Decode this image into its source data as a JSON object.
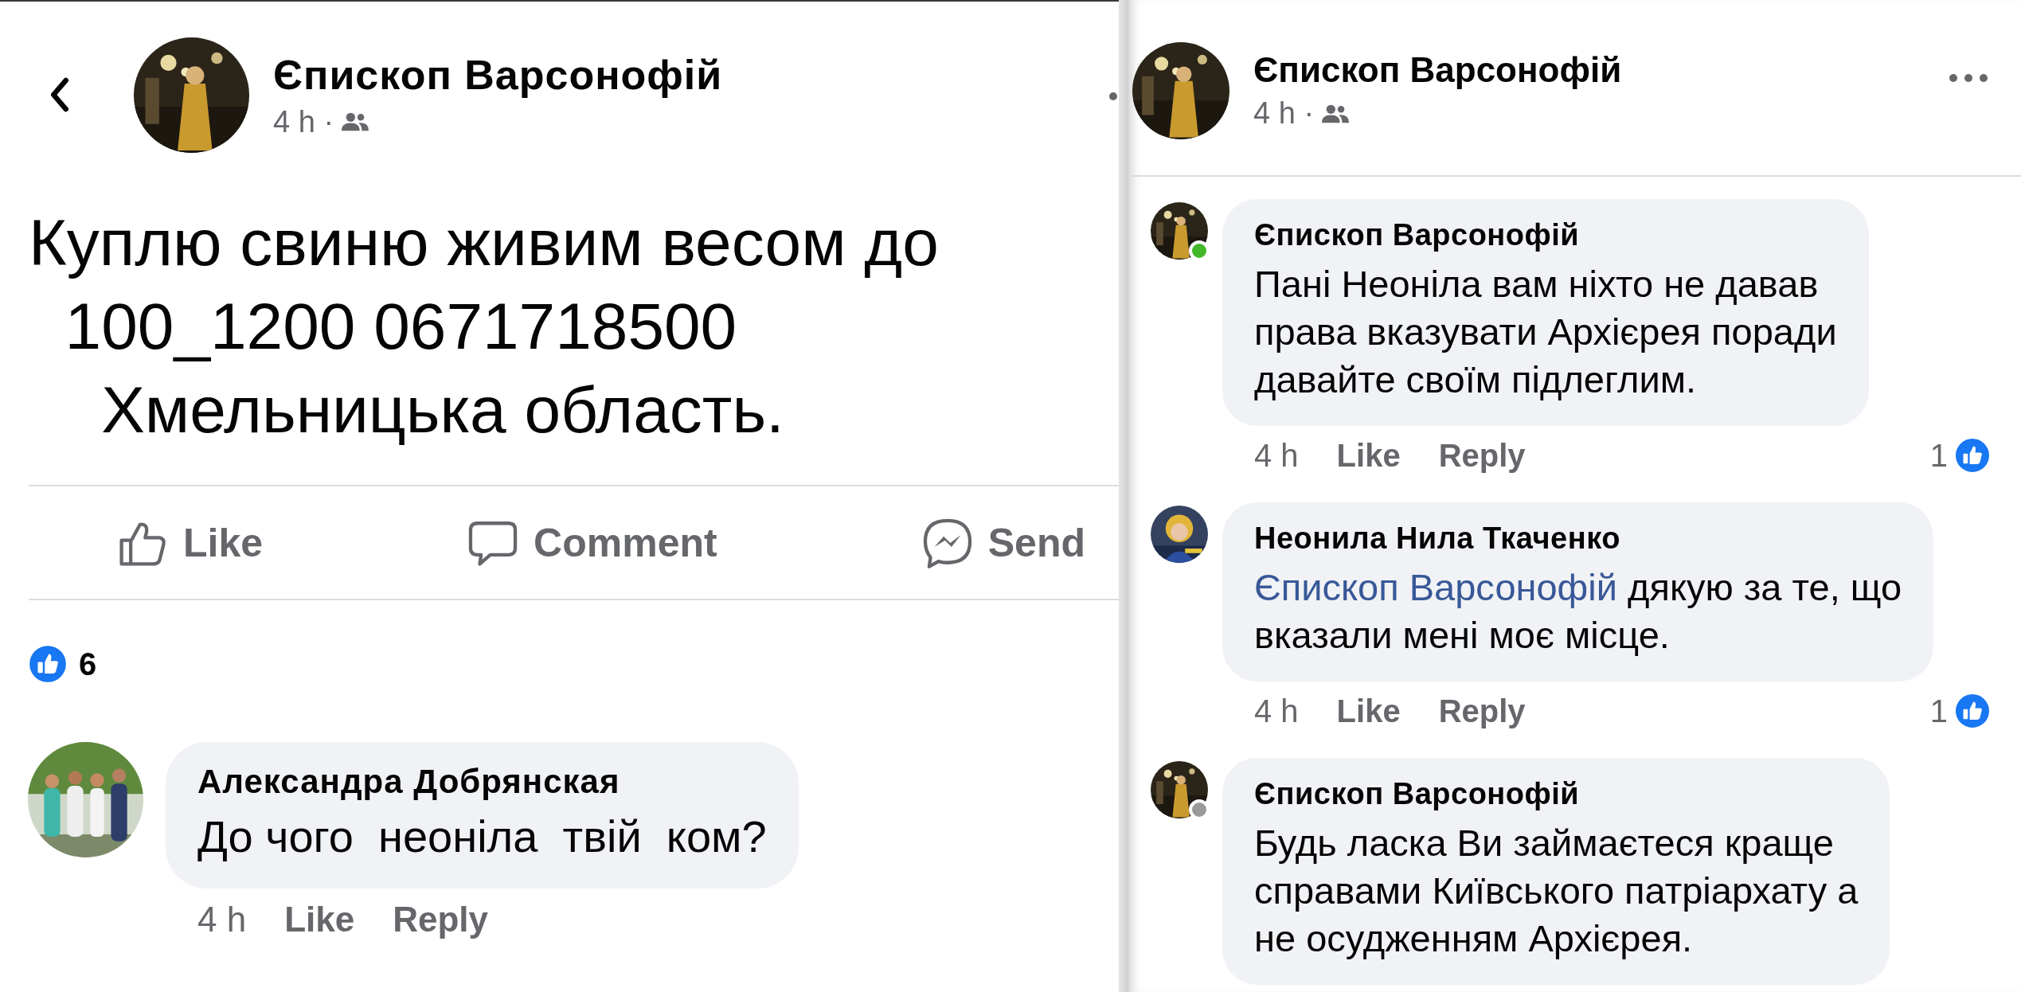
{
  "left_post": {
    "author": "Єпископ Варсонофій",
    "time": "4 h ·",
    "text_lines": [
      "Куплю свиню живим весом до",
      "  100_1200 0671718500",
      "    Хмельницька область."
    ],
    "actions": [
      {
        "kind": "like",
        "label": "Like"
      },
      {
        "kind": "comment",
        "label": "Comment"
      },
      {
        "kind": "send",
        "label": "Send"
      }
    ],
    "reactions": {
      "count": "6"
    },
    "comments": [
      {
        "author": "Александра Добрянская",
        "text": "До чого  неоніла  твій  ком?",
        "time": "4 h",
        "like": "Like",
        "reply": "Reply"
      }
    ]
  },
  "right_post": {
    "author": "Єпископ Варсонофій",
    "time": "4 h ·",
    "comments": [
      {
        "author": "Єпископ Варсонофій",
        "active": true,
        "text": "Пані Неоніла вам ніхто не давав\nправа вказувати Архієрея поради\nдавайте своїм підлеглим.",
        "time": "4 h",
        "like": "Like",
        "reply": "Reply",
        "reaction_count": "1"
      },
      {
        "author": "Неонила Нила Ткаченко",
        "mention": "Єпископ Варсонофій",
        "text": "дякую за те, що\nвказали мені моє місце.",
        "time": "4 h",
        "like": "Like",
        "reply": "Reply",
        "reaction_count": "1"
      },
      {
        "author": "Єпископ Варсонофій",
        "active": false,
        "text": "Будь ласка Ви займаєтеся краще\nсправами Київського патріархату а\nне осудженням Архієрея."
      }
    ]
  }
}
